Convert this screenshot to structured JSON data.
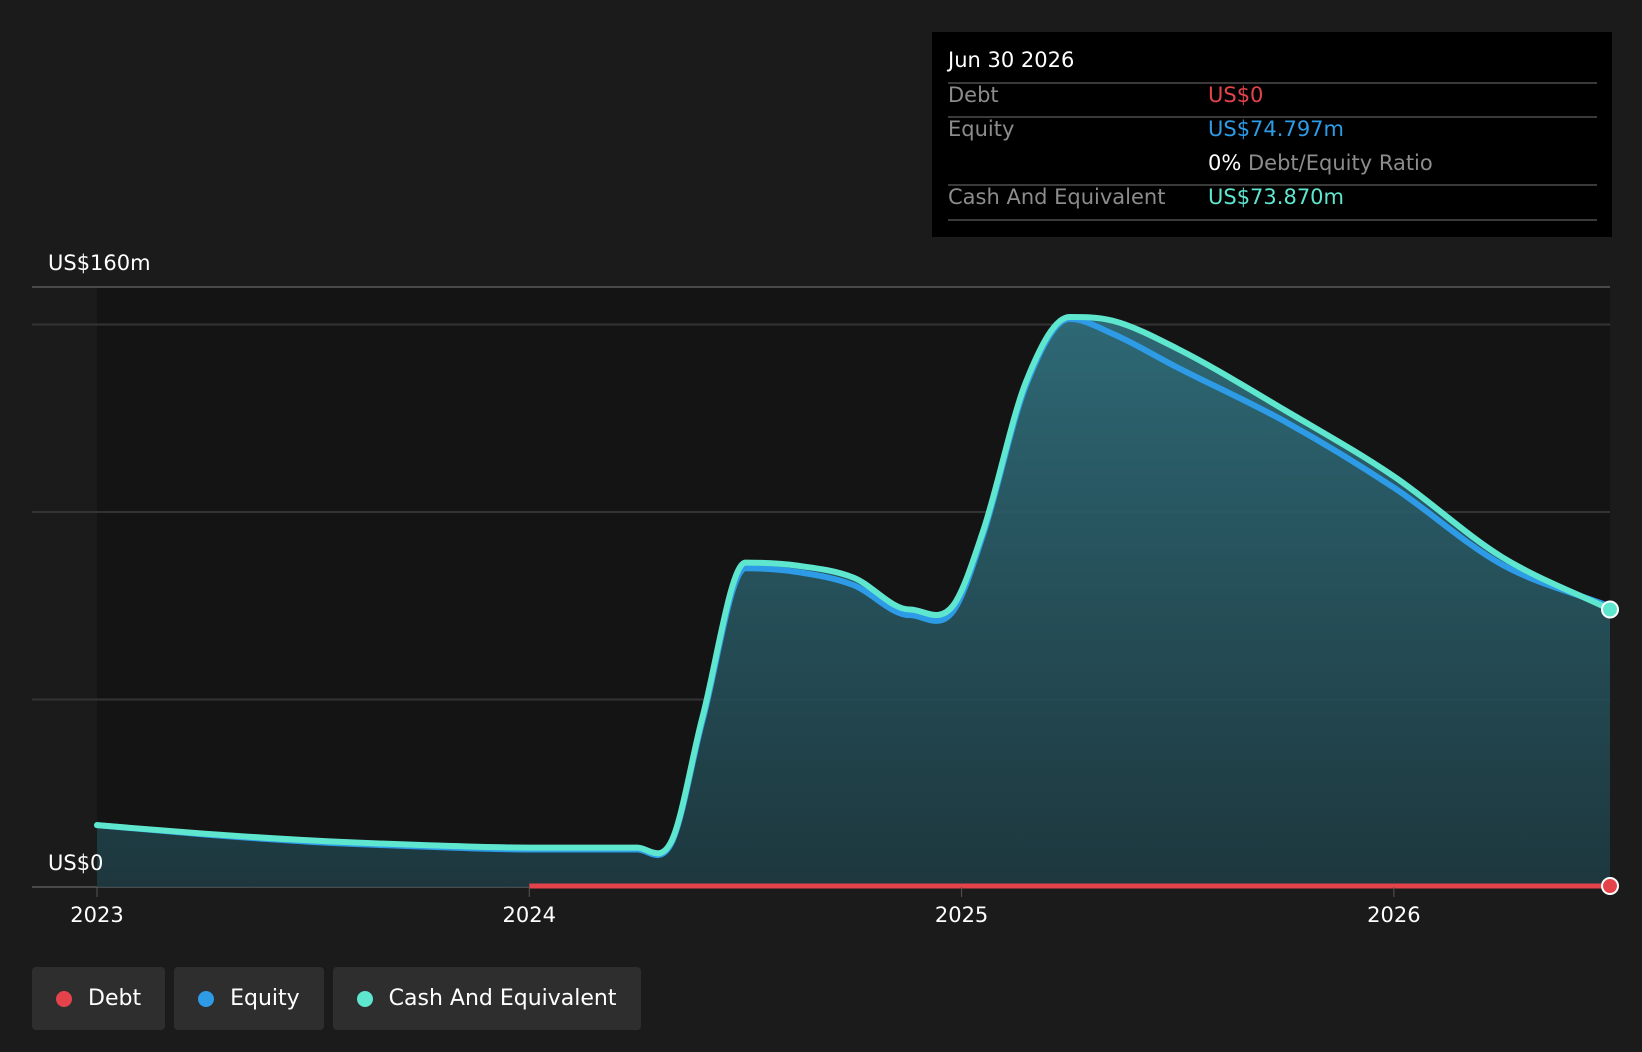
{
  "colors": {
    "background": "#1b1b1b",
    "debt": "#e5434c",
    "equity": "#2e9be6",
    "cash": "#5ee6cf",
    "grid": "#333333"
  },
  "tooltip": {
    "date": "Jun 30 2026",
    "rows": {
      "debt": {
        "label": "Debt",
        "value": "US$0"
      },
      "equity": {
        "label": "Equity",
        "value": "US$74.797m"
      },
      "ratio": {
        "pct": "0%",
        "label": "Debt/Equity Ratio"
      },
      "cash": {
        "label": "Cash And Equivalent",
        "value": "US$73.870m"
      }
    }
  },
  "legend": {
    "debt": "Debt",
    "equity": "Equity",
    "cash": "Cash And Equivalent"
  },
  "chart_data": {
    "type": "area",
    "ylabel_top": "US$160m",
    "ylabel_bottom": "US$0",
    "ylim": [
      0,
      160
    ],
    "xlim": [
      2022.85,
      2026.5
    ],
    "x_ticks": [
      {
        "label": "2023",
        "value": 2023.0
      },
      {
        "label": "2024",
        "value": 2024.0
      },
      {
        "label": "2025",
        "value": 2025.0
      },
      {
        "label": "2026",
        "value": 2026.0
      }
    ],
    "y_gridlines": [
      0,
      50,
      100,
      150,
      160
    ],
    "series": [
      {
        "name": "Cash And Equivalent",
        "key": "cash",
        "x": [
          2023.0,
          2023.25,
          2023.5,
          2023.75,
          2024.0,
          2024.25,
          2024.33,
          2024.4,
          2024.5,
          2024.62,
          2024.75,
          2024.88,
          2024.98,
          2025.05,
          2025.15,
          2025.25,
          2025.35,
          2025.5,
          2025.75,
          2026.0,
          2026.25,
          2026.5
        ],
        "values": [
          16.5,
          14.2,
          12.4,
          11.2,
          10.5,
          10.5,
          12.5,
          45.0,
          86.5,
          85.7,
          82.5,
          74.0,
          75.0,
          95.0,
          135.0,
          152.0,
          151.0,
          143.5,
          127.0,
          109.5,
          88.0,
          74.0
        ]
      },
      {
        "name": "Equity",
        "key": "equity",
        "x": [
          2023.0,
          2023.25,
          2023.5,
          2023.75,
          2024.0,
          2024.25,
          2024.33,
          2024.4,
          2024.5,
          2024.62,
          2024.75,
          2024.88,
          2024.98,
          2025.05,
          2025.15,
          2025.25,
          2025.35,
          2025.5,
          2025.75,
          2026.0,
          2026.25,
          2026.5
        ],
        "values": [
          16.5,
          14.0,
          12.0,
          10.8,
          10.0,
          10.0,
          12.0,
          44.0,
          85.0,
          84.0,
          80.5,
          72.5,
          73.5,
          94.0,
          134.0,
          151.5,
          147.5,
          138.5,
          124.0,
          106.5,
          86.0,
          74.8
        ]
      },
      {
        "name": "Debt",
        "key": "debt",
        "x": [
          2024.0,
          2026.5
        ],
        "values": [
          0,
          0
        ]
      }
    ]
  }
}
